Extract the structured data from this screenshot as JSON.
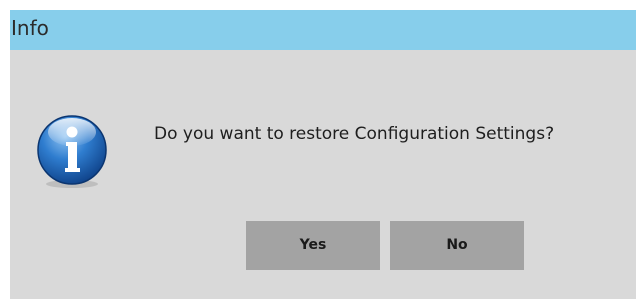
{
  "dialog": {
    "title": "Info",
    "icon": "info-icon",
    "message": "Do you want to restore Configuration Settings?",
    "buttons": {
      "yes_label": "Yes",
      "no_label": "No"
    }
  },
  "colors": {
    "titlebar": "#87ceeb",
    "dialog_background": "#d9d9d9",
    "button_background": "#a3a3a3"
  }
}
